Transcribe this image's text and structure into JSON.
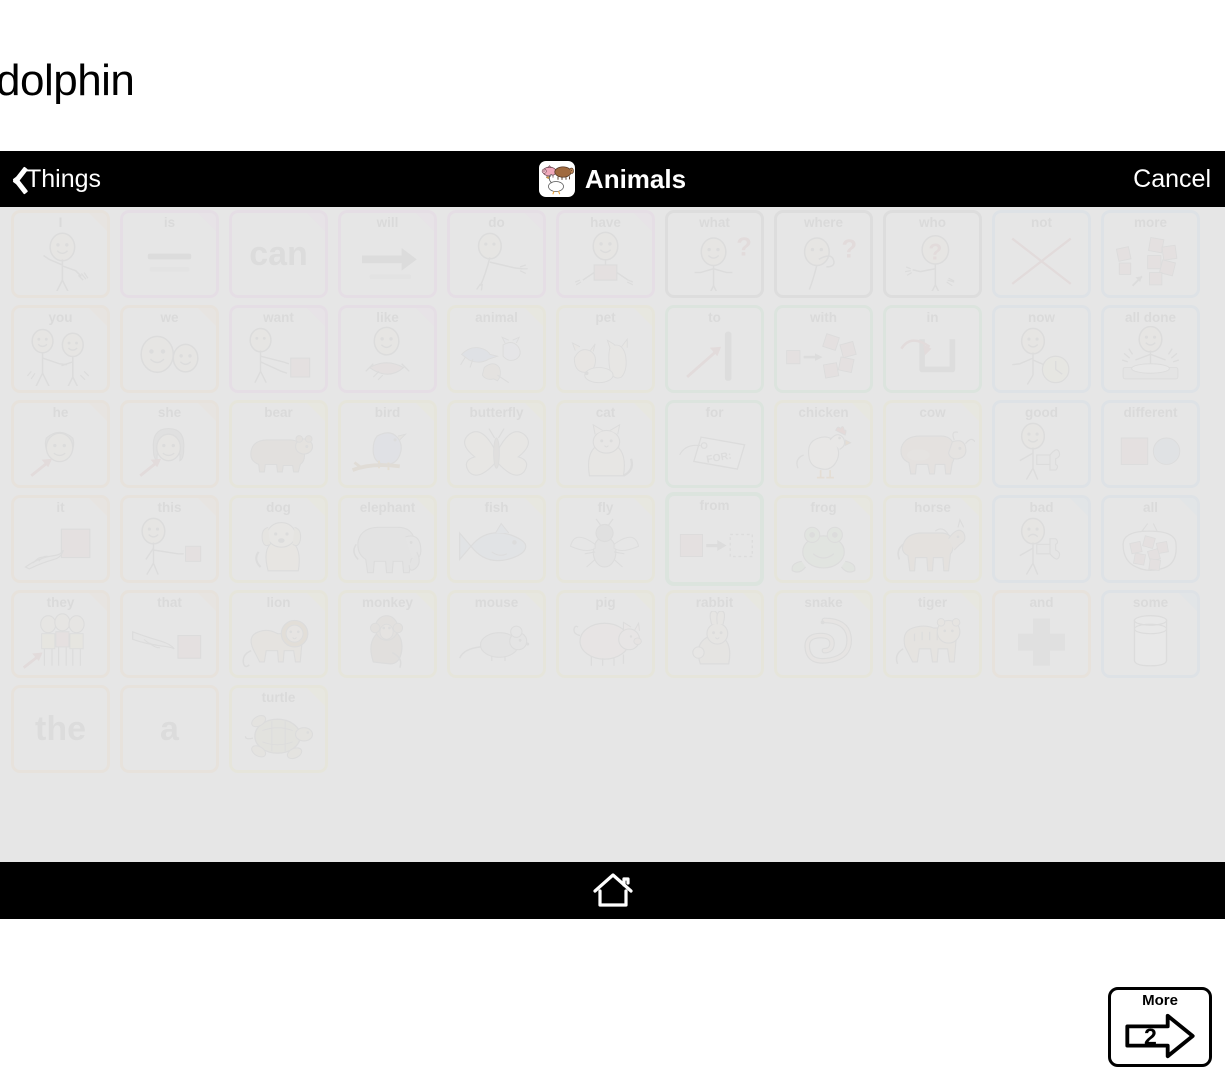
{
  "message_bar": {
    "text": "dolphin"
  },
  "navbar": {
    "back_label": "Things",
    "back_icon": "chevron-left-icon",
    "title": "Animals",
    "title_icon": "farm-animals-icon",
    "cancel_label": "Cancel"
  },
  "bottombar": {
    "home_icon": "home-icon"
  },
  "more_button": {
    "label": "More",
    "page_number": "2",
    "icon": "right-arrow-icon"
  },
  "colors": {
    "navbar_bg": "#000000",
    "board_bg": "#e6e6e6",
    "button_bg": "#e9e9e9",
    "pronoun_orange": "#eec79b",
    "verb_pink": "#e5a9e2",
    "question_gray": "#9e9e9e",
    "descriptor_blue": "#a8cbe8",
    "noun_yellow": "#ece58f",
    "preposition_green": "#96dca8",
    "label_text": "#8c8c8c"
  },
  "grid": {
    "columns": 11,
    "rows": 6,
    "buttons": [
      {
        "label": "I",
        "color": "orange",
        "icon": "person-pointing-self-icon",
        "fold": true,
        "row": 1,
        "col": 1
      },
      {
        "label": "is",
        "color": "pink",
        "icon": "equals-lines-icon",
        "fold": true,
        "row": 1,
        "col": 2
      },
      {
        "label": "can",
        "color": "pink",
        "icon": "text-can",
        "fold": true,
        "row": 1,
        "col": 3,
        "bigword": "can"
      },
      {
        "label": "will",
        "color": "pink",
        "icon": "arrow-right-icon",
        "fold": true,
        "row": 1,
        "col": 4
      },
      {
        "label": "do",
        "color": "pink",
        "icon": "person-reaching-icon",
        "fold": true,
        "row": 1,
        "col": 5
      },
      {
        "label": "have",
        "color": "pink",
        "icon": "person-holding-box-icon",
        "fold": true,
        "row": 1,
        "col": 6
      },
      {
        "label": "what",
        "color": "gray",
        "icon": "person-question-icon",
        "fold": false,
        "row": 1,
        "col": 7
      },
      {
        "label": "where",
        "color": "gray",
        "icon": "person-looking-question-icon",
        "fold": false,
        "row": 1,
        "col": 8
      },
      {
        "label": "who",
        "color": "gray",
        "icon": "person-question-head-icon",
        "fold": false,
        "row": 1,
        "col": 9
      },
      {
        "label": "not",
        "color": "blue",
        "icon": "red-x-icon",
        "fold": false,
        "row": 1,
        "col": 10
      },
      {
        "label": "more",
        "color": "blue",
        "icon": "more-blocks-icon",
        "fold": false,
        "row": 1,
        "col": 11
      },
      {
        "label": "you",
        "color": "orange",
        "icon": "two-people-pointing-icon",
        "fold": true,
        "row": 2,
        "col": 1
      },
      {
        "label": "we",
        "color": "orange",
        "icon": "two-faces-icon",
        "fold": true,
        "row": 2,
        "col": 2
      },
      {
        "label": "want",
        "color": "pink",
        "icon": "person-reaching-box-icon",
        "fold": true,
        "row": 2,
        "col": 3
      },
      {
        "label": "like",
        "color": "pink",
        "icon": "person-hugging-hearts-icon",
        "fold": true,
        "row": 2,
        "col": 4
      },
      {
        "label": "animal",
        "color": "yellow",
        "icon": "animals-group-icon",
        "fold": true,
        "row": 2,
        "col": 5
      },
      {
        "label": "pet",
        "color": "yellow",
        "icon": "pets-group-icon",
        "fold": true,
        "row": 2,
        "col": 6
      },
      {
        "label": "to",
        "color": "green",
        "icon": "arrow-to-bar-icon",
        "fold": false,
        "row": 2,
        "col": 7
      },
      {
        "label": "with",
        "color": "green",
        "icon": "blocks-joining-icon",
        "fold": false,
        "row": 2,
        "col": 8
      },
      {
        "label": "in",
        "color": "green",
        "icon": "arrow-into-container-icon",
        "fold": false,
        "row": 2,
        "col": 9
      },
      {
        "label": "now",
        "color": "blue",
        "icon": "person-clock-icon",
        "fold": false,
        "row": 2,
        "col": 10
      },
      {
        "label": "all done",
        "color": "blue",
        "icon": "person-hands-up-icon",
        "fold": false,
        "row": 2,
        "col": 11
      },
      {
        "label": "he",
        "color": "orange",
        "icon": "boy-face-arrow-icon",
        "fold": true,
        "row": 3,
        "col": 1
      },
      {
        "label": "she",
        "color": "orange",
        "icon": "girl-face-arrow-icon",
        "fold": true,
        "row": 3,
        "col": 2
      },
      {
        "label": "bear",
        "color": "yellow",
        "icon": "bear-icon",
        "fold": true,
        "row": 3,
        "col": 3
      },
      {
        "label": "bird",
        "color": "yellow",
        "icon": "bird-on-branch-icon",
        "fold": true,
        "row": 3,
        "col": 4
      },
      {
        "label": "butterfly",
        "color": "yellow",
        "icon": "butterfly-icon",
        "fold": true,
        "row": 3,
        "col": 5
      },
      {
        "label": "cat",
        "color": "yellow",
        "icon": "cat-icon",
        "fold": true,
        "row": 3,
        "col": 6
      },
      {
        "label": "for",
        "color": "green",
        "icon": "price-tag-for-icon",
        "fold": false,
        "row": 3,
        "col": 7
      },
      {
        "label": "chicken",
        "color": "yellow",
        "icon": "chicken-icon",
        "fold": true,
        "row": 3,
        "col": 8
      },
      {
        "label": "cow",
        "color": "yellow",
        "icon": "cow-icon",
        "fold": true,
        "row": 3,
        "col": 9
      },
      {
        "label": "good",
        "color": "blue",
        "icon": "person-thumbs-up-icon",
        "fold": false,
        "row": 3,
        "col": 10
      },
      {
        "label": "different",
        "color": "blue",
        "icon": "square-circle-icon",
        "fold": false,
        "row": 3,
        "col": 11
      },
      {
        "label": "it",
        "color": "orange",
        "icon": "hand-pointing-box-icon",
        "fold": true,
        "row": 4,
        "col": 1
      },
      {
        "label": "this",
        "color": "orange",
        "icon": "person-pointing-box-icon",
        "fold": true,
        "row": 4,
        "col": 2
      },
      {
        "label": "dog",
        "color": "yellow",
        "icon": "dog-icon",
        "fold": true,
        "row": 4,
        "col": 3
      },
      {
        "label": "elephant",
        "color": "yellow",
        "icon": "elephant-icon",
        "fold": true,
        "row": 4,
        "col": 4
      },
      {
        "label": "fish",
        "color": "yellow",
        "icon": "fish-icon",
        "fold": true,
        "row": 4,
        "col": 5
      },
      {
        "label": "fly",
        "color": "yellow",
        "icon": "fly-insect-icon",
        "fold": true,
        "row": 4,
        "col": 6
      },
      {
        "label": "from",
        "color": "green",
        "icon": "box-arrow-dashed-icon",
        "fold": false,
        "row": 4,
        "col": 7,
        "selected": true
      },
      {
        "label": "frog",
        "color": "yellow",
        "icon": "frog-icon",
        "fold": true,
        "row": 4,
        "col": 8
      },
      {
        "label": "horse",
        "color": "yellow",
        "icon": "horse-icon",
        "fold": true,
        "row": 4,
        "col": 9
      },
      {
        "label": "bad",
        "color": "blue",
        "icon": "person-thumbs-down-icon",
        "fold": true,
        "row": 4,
        "col": 10
      },
      {
        "label": "all",
        "color": "blue",
        "icon": "bag-of-blocks-icon",
        "fold": true,
        "row": 4,
        "col": 11
      },
      {
        "label": "they",
        "color": "orange",
        "icon": "three-people-arrow-icon",
        "fold": true,
        "row": 5,
        "col": 1
      },
      {
        "label": "that",
        "color": "orange",
        "icon": "hand-pointing-far-box-icon",
        "fold": true,
        "row": 5,
        "col": 2
      },
      {
        "label": "lion",
        "color": "yellow",
        "icon": "lion-icon",
        "fold": true,
        "row": 5,
        "col": 3
      },
      {
        "label": "monkey",
        "color": "yellow",
        "icon": "monkey-icon",
        "fold": true,
        "row": 5,
        "col": 4
      },
      {
        "label": "mouse",
        "color": "yellow",
        "icon": "mouse-icon",
        "fold": true,
        "row": 5,
        "col": 5
      },
      {
        "label": "pig",
        "color": "yellow",
        "icon": "pig-icon",
        "fold": true,
        "row": 5,
        "col": 6
      },
      {
        "label": "rabbit",
        "color": "yellow",
        "icon": "rabbit-icon",
        "fold": true,
        "row": 5,
        "col": 7
      },
      {
        "label": "snake",
        "color": "yellow",
        "icon": "snake-icon",
        "fold": true,
        "row": 5,
        "col": 8
      },
      {
        "label": "tiger",
        "color": "yellow",
        "icon": "tiger-icon",
        "fold": true,
        "row": 5,
        "col": 9
      },
      {
        "label": "and",
        "color": "orange",
        "icon": "plus-cross-icon",
        "fold": false,
        "row": 5,
        "col": 10
      },
      {
        "label": "some",
        "color": "blue",
        "icon": "cup-partial-icon",
        "fold": true,
        "row": 5,
        "col": 11
      },
      {
        "label": "the",
        "color": "orange",
        "icon": "text-the",
        "fold": false,
        "row": 6,
        "col": 1,
        "bigword": "the"
      },
      {
        "label": "a",
        "color": "orange",
        "icon": "text-a",
        "fold": false,
        "row": 6,
        "col": 2,
        "bigword": "a"
      },
      {
        "label": "turtle",
        "color": "yellow",
        "icon": "turtle-icon",
        "fold": true,
        "row": 6,
        "col": 3
      }
    ]
  }
}
